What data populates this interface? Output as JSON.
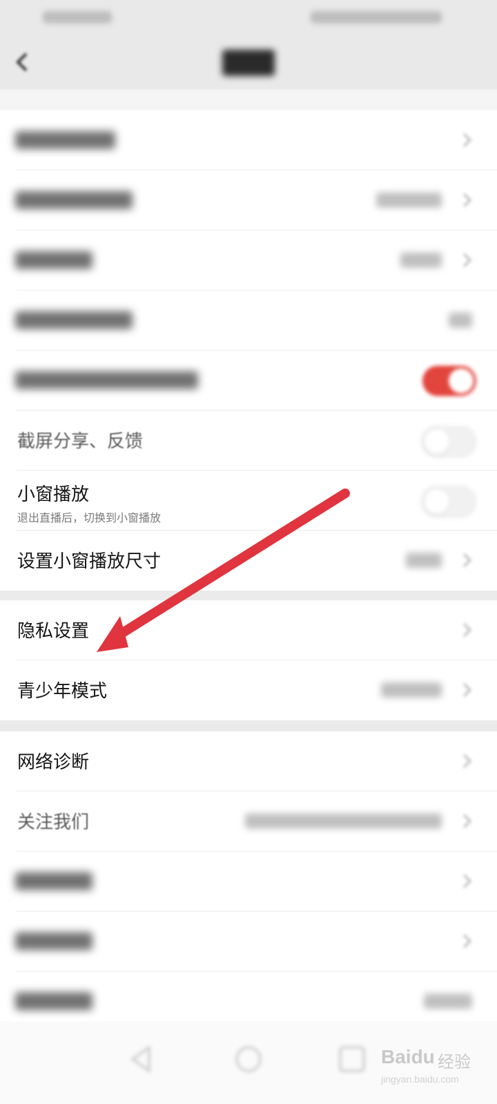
{
  "rows": {
    "screenshot_share": {
      "label": "截屏分享、反馈"
    },
    "mini_window": {
      "label": "小窗播放",
      "sublabel": "退出直播后，切换到小窗播放"
    },
    "mini_window_size": {
      "label": "设置小窗播放尺寸"
    },
    "privacy": {
      "label": "隐私设置"
    },
    "youth_mode": {
      "label": "青少年模式"
    },
    "network_diagnosis": {
      "label": "网络诊断"
    },
    "follow_us": {
      "label": "关注我们"
    }
  },
  "toggles": {
    "blurred_row_5": "on",
    "screenshot_share": "off",
    "mini_window": "off"
  },
  "annotation": {
    "arrow_color": "#e0343f",
    "arrow_target": "隐私设置"
  },
  "watermark": {
    "brand": "Baidu",
    "text": "经验",
    "url": "jingyan.baidu.com"
  },
  "colors": {
    "toggle_on": "#e2453d",
    "background": "#f7f7f7"
  }
}
